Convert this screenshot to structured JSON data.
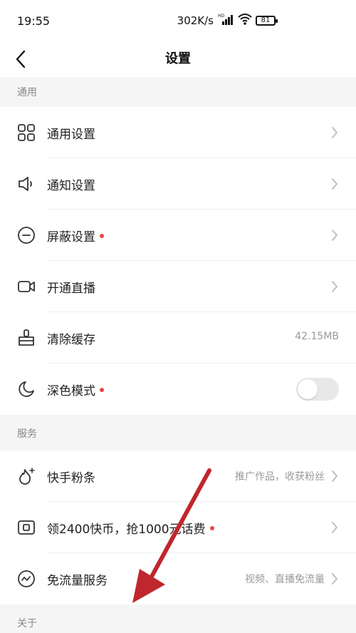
{
  "status": {
    "time": "19:55",
    "net_speed": "302K/s",
    "battery": "81"
  },
  "nav": {
    "title": "设置"
  },
  "sections": [
    {
      "header": "通用",
      "items": [
        {
          "label": "通用设置",
          "icon": "grid-icon",
          "red_dot": false,
          "value": "",
          "chevron": true,
          "toggle": false
        },
        {
          "label": "通知设置",
          "icon": "speaker-icon",
          "red_dot": false,
          "value": "",
          "chevron": true,
          "toggle": false
        },
        {
          "label": "屏蔽设置",
          "icon": "minus-circle-icon",
          "red_dot": true,
          "value": "",
          "chevron": true,
          "toggle": false
        },
        {
          "label": "开通直播",
          "icon": "video-camera-icon",
          "red_dot": false,
          "value": "",
          "chevron": true,
          "toggle": false
        },
        {
          "label": "清除缓存",
          "icon": "broom-icon",
          "red_dot": false,
          "value": "42.15MB",
          "chevron": false,
          "toggle": false
        },
        {
          "label": "深色模式",
          "icon": "moon-icon",
          "red_dot": true,
          "value": "",
          "chevron": false,
          "toggle": true,
          "toggle_on": false
        }
      ]
    },
    {
      "header": "服务",
      "items": [
        {
          "label": "快手粉条",
          "icon": "flame-plus-icon",
          "red_dot": false,
          "value": "推广作品，收获粉丝",
          "chevron": true,
          "toggle": false
        },
        {
          "label": "领2400快币，抢1000元话费",
          "icon": "coin-card-icon",
          "red_dot": true,
          "value": "",
          "chevron": true,
          "toggle": false
        },
        {
          "label": "免流量服务",
          "icon": "wave-circle-icon",
          "red_dot": false,
          "value": "视频、直播免流量",
          "chevron": true,
          "toggle": false
        }
      ]
    },
    {
      "header": "关于",
      "items": []
    }
  ],
  "colors": {
    "annotation_arrow": "#c0262d",
    "red_dot": "#e94646"
  }
}
